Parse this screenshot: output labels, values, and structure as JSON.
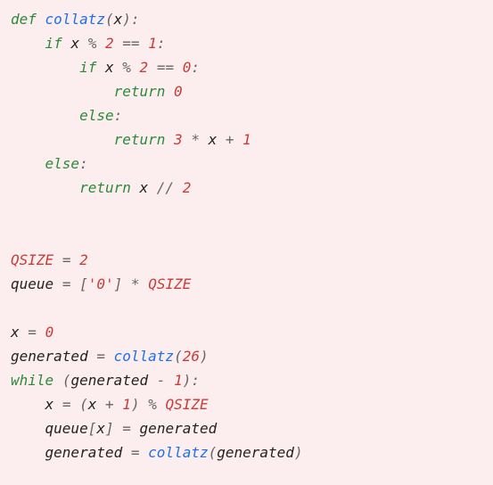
{
  "code": {
    "l1": {
      "kw_def": "def",
      "fn": "collatz",
      "p1": "(",
      "arg": "x",
      "p2": "):"
    },
    "l2": {
      "kw_if": "if",
      "x": "x",
      "mod": "%",
      "two": "2",
      "eq": "==",
      "one": "1",
      "colon": ":"
    },
    "l3": {
      "kw_if": "if",
      "x": "x",
      "mod": "%",
      "two": "2",
      "eq": "==",
      "zero": "0",
      "colon": ":"
    },
    "l4": {
      "kw_return": "return",
      "zero": "0"
    },
    "l5": {
      "kw_else": "else",
      "colon": ":"
    },
    "l6": {
      "kw_return": "return",
      "three": "3",
      "star": "*",
      "x": "x",
      "plus": "+",
      "one": "1"
    },
    "l7": {
      "kw_else": "else",
      "colon": ":"
    },
    "l8": {
      "kw_return": "return",
      "x": "x",
      "fdiv": "//",
      "two": "2"
    },
    "l11": {
      "name": "QSIZE",
      "eq": "=",
      "val": "2"
    },
    "l12": {
      "name": "queue",
      "eq": "=",
      "lb": "[",
      "str": "'0'",
      "rb": "]",
      "star": "*",
      "qs": "QSIZE"
    },
    "l14": {
      "x": "x",
      "eq": "=",
      "zero": "0"
    },
    "l15": {
      "g": "generated",
      "eq": "=",
      "fn": "collatz",
      "p1": "(",
      "n": "26",
      "p2": ")"
    },
    "l16": {
      "kw_while": "while",
      "p1": "(",
      "g": "generated",
      "minus": "-",
      "one": "1",
      "p2": "):"
    },
    "l17": {
      "x1": "x",
      "eq": "=",
      "p1": "(",
      "x2": "x",
      "plus": "+",
      "one": "1",
      "p2": ")",
      "mod": "%",
      "qs": "QSIZE"
    },
    "l18": {
      "q": "queue",
      "lb": "[",
      "x": "x",
      "rb": "]",
      "eq": "=",
      "g": "generated"
    },
    "l19": {
      "g1": "generated",
      "eq": "=",
      "fn": "collatz",
      "p1": "(",
      "g2": "generated",
      "p2": ")"
    }
  }
}
